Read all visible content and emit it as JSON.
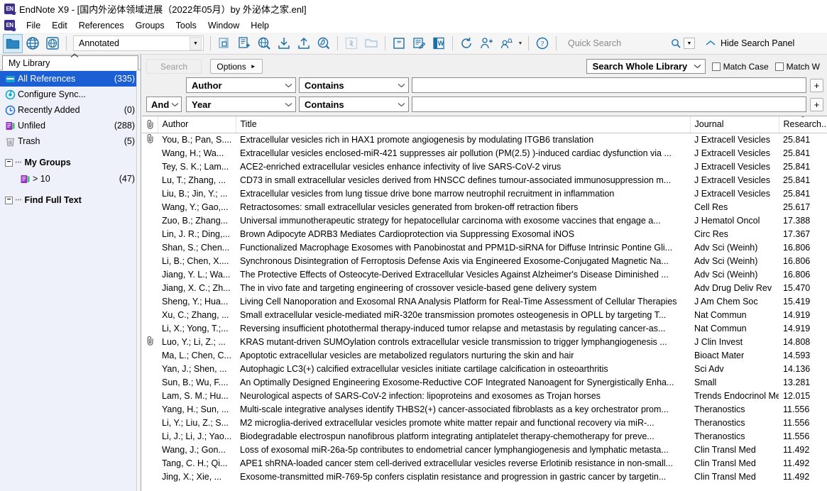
{
  "window": {
    "title": "EndNote X9 - [国内外泌体领域进展（2022年05月）by 外泌体之家.enl]",
    "logo_text": "EN"
  },
  "menu": {
    "items": [
      "File",
      "Edit",
      "References",
      "Groups",
      "Tools",
      "Window",
      "Help"
    ]
  },
  "toolbar": {
    "style_select": "Annotated",
    "icons": [
      "open-library-icon",
      "online-search-icon",
      "online-search-mode-icon",
      "copy-references-icon",
      "new-reference-icon",
      "online-search-find-icon",
      "import-icon",
      "export-icon",
      "find-full-text-icon",
      "link-icon",
      "open-file-folder-icon",
      "insert-citation-icon",
      "format-bibliography-icon",
      "word-icon",
      "sync-icon",
      "share-library-icon",
      "activity-feed-icon",
      "help-icon"
    ],
    "quick_search_placeholder": "Quick Search",
    "hide_search_panel": "Hide Search Panel"
  },
  "sidebar": {
    "library_tab": "My Library",
    "items": [
      {
        "label": "All References",
        "count": "(335)",
        "icon": "all-references-icon",
        "selected": true
      },
      {
        "label": "Configure Sync...",
        "count": "",
        "icon": "sync-config-icon",
        "selected": false
      },
      {
        "label": "Recently Added",
        "count": "(0)",
        "icon": "recently-added-icon",
        "selected": false
      },
      {
        "label": "Unfiled",
        "count": "(288)",
        "icon": "unfiled-icon",
        "selected": false
      },
      {
        "label": "Trash",
        "count": "(5)",
        "icon": "trash-icon",
        "selected": false
      }
    ],
    "my_groups_header": "My Groups",
    "groups": [
      {
        "label": "> 10",
        "count": "(47)",
        "icon": "group-icon"
      }
    ],
    "find_full_text_header": "Find Full Text"
  },
  "search_panel": {
    "search_button": "Search",
    "options_button": "Options",
    "scope_select": "Search Whole Library",
    "match_case": "Match Case",
    "match_words": "Match W",
    "rows": [
      {
        "bool": "",
        "field": "Author",
        "operator": "Contains",
        "term": ""
      },
      {
        "bool": "And",
        "field": "Year",
        "operator": "Contains",
        "term": ""
      }
    ],
    "add_row_label": "+"
  },
  "table": {
    "columns": {
      "clip": "",
      "author": "Author",
      "title": "Title",
      "journal": "Journal",
      "rating": "Research..."
    },
    "sort_column": "rating",
    "sort_direction": "descending",
    "rows": [
      {
        "clip": true,
        "author": "You, B.; Pan, S....",
        "title": "Extracellular vesicles rich in HAX1 promote angiogenesis by modulating ITGB6 translation",
        "journal": "J Extracell Vesicles",
        "rating": "25.841"
      },
      {
        "clip": false,
        "author": "Wang, H.; Wa...",
        "title": "Extracellular vesicles enclosed-miR-421 suppresses air pollution (PM(2.5) )-induced cardiac dysfunction via ...",
        "journal": "J Extracell Vesicles",
        "rating": "25.841"
      },
      {
        "clip": false,
        "author": "Tey, S. K.; Lam...",
        "title": "ACE2-enriched extracellular vesicles enhance infectivity of live SARS-CoV-2 virus",
        "journal": "J Extracell Vesicles",
        "rating": "25.841"
      },
      {
        "clip": false,
        "author": "Lu, T.; Zhang, ...",
        "title": "CD73 in small extracellular vesicles derived from HNSCC defines tumour-associated immunosuppression m...",
        "journal": "J Extracell Vesicles",
        "rating": "25.841"
      },
      {
        "clip": false,
        "author": "Liu, B.; Jin, Y.; ...",
        "title": "Extracellular vesicles from lung tissue drive bone marrow neutrophil recruitment in inflammation",
        "journal": "J Extracell Vesicles",
        "rating": "25.841"
      },
      {
        "clip": false,
        "author": "Wang, Y.; Gao,...",
        "title": "Retractosomes: small extracellular vesicles generated from broken-off retraction fibers",
        "journal": "Cell Res",
        "rating": "25.617"
      },
      {
        "clip": false,
        "author": "Zuo, B.; Zhang...",
        "title": "Universal immunotherapeutic strategy for hepatocellular carcinoma with exosome vaccines that engage a...",
        "journal": "J Hematol Oncol",
        "rating": "17.388"
      },
      {
        "clip": false,
        "author": "Lin, J. R.; Ding,...",
        "title": "Brown Adipocyte ADRB3 Mediates Cardioprotection via Suppressing Exosomal iNOS",
        "journal": "Circ Res",
        "rating": "17.367"
      },
      {
        "clip": false,
        "author": "Shan, S.; Chen...",
        "title": "Functionalized Macrophage Exosomes with Panobinostat and PPM1D-siRNA for Diffuse Intrinsic Pontine Gli...",
        "journal": "Adv Sci (Weinh)",
        "rating": "16.806"
      },
      {
        "clip": false,
        "author": "Li, B.; Chen, X....",
        "title": "Synchronous Disintegration of Ferroptosis Defense Axis via Engineered Exosome-Conjugated Magnetic Na...",
        "journal": "Adv Sci (Weinh)",
        "rating": "16.806"
      },
      {
        "clip": false,
        "author": "Jiang, Y. L.; Wa...",
        "title": "The Protective Effects of Osteocyte-Derived Extracellular Vesicles Against Alzheimer's Disease Diminished ...",
        "journal": "Adv Sci (Weinh)",
        "rating": "16.806"
      },
      {
        "clip": false,
        "author": "Jiang, X. C.; Zh...",
        "title": "The in vivo fate and targeting engineering of crossover vesicle-based gene delivery system",
        "journal": "Adv Drug Deliv Rev",
        "rating": "15.470"
      },
      {
        "clip": false,
        "author": "Sheng, Y.; Hua...",
        "title": "Living Cell Nanoporation and Exosomal RNA Analysis Platform for Real-Time Assessment of Cellular Therapies",
        "journal": "J Am Chem Soc",
        "rating": "15.419"
      },
      {
        "clip": false,
        "author": "Xu, C.; Zhang, ...",
        "title": "Small extracellular vesicle-mediated miR-320e transmission promotes osteogenesis in OPLL by targeting T...",
        "journal": "Nat Commun",
        "rating": "14.919"
      },
      {
        "clip": false,
        "author": "Li, X.; Yong, T.;...",
        "title": "Reversing insufficient photothermal therapy-induced tumor relapse and metastasis by regulating cancer-as...",
        "journal": "Nat Commun",
        "rating": "14.919"
      },
      {
        "clip": true,
        "author": "Luo, Y.; Li, Z.; ...",
        "title": "KRAS mutant-driven SUMOylation controls extracellular vesicle transmission to trigger lymphangiogenesis ...",
        "journal": "J Clin Invest",
        "rating": "14.808"
      },
      {
        "clip": false,
        "author": "Ma, L.; Chen, C...",
        "title": "Apoptotic extracellular vesicles are metabolized regulators nurturing the skin and hair",
        "journal": "Bioact Mater",
        "rating": "14.593"
      },
      {
        "clip": false,
        "author": "Yan, J.; Shen, ...",
        "title": "Autophagic LC3(+) calcified extracellular vesicles initiate cartilage calcification in osteoarthritis",
        "journal": "Sci Adv",
        "rating": "14.136"
      },
      {
        "clip": false,
        "author": "Sun, B.; Wu, F....",
        "title": "An Optimally Designed Engineering Exosome-Reductive COF Integrated Nanoagent for Synergistically Enha...",
        "journal": "Small",
        "rating": "13.281"
      },
      {
        "clip": false,
        "author": "Lam, S. M.; Hu...",
        "title": "Neurological aspects of SARS-CoV-2 infection: lipoproteins and exosomes as Trojan horses",
        "journal": "Trends Endocrinol Me...",
        "rating": "12.015"
      },
      {
        "clip": false,
        "author": "Yang, H.; Sun, ...",
        "title": "Multi-scale integrative analyses identify THBS2(+) cancer-associated fibroblasts as a key orchestrator prom...",
        "journal": "Theranostics",
        "rating": "11.556"
      },
      {
        "clip": false,
        "author": "Li, Y.; Liu, Z.; S...",
        "title": "M2 microglia-derived extracellular vesicles promote white matter repair and functional recovery via miR-...",
        "journal": "Theranostics",
        "rating": "11.556"
      },
      {
        "clip": false,
        "author": "Li, J.; Li, J.; Yao...",
        "title": "Biodegradable electrospun nanofibrous platform integrating antiplatelet therapy-chemotherapy for preve...",
        "journal": "Theranostics",
        "rating": "11.556"
      },
      {
        "clip": false,
        "author": "Wang, J.; Gon...",
        "title": "Loss of exosomal miR-26a-5p contributes to endometrial cancer lymphangiogenesis and lymphatic metasta...",
        "journal": "Clin Transl Med",
        "rating": "11.492"
      },
      {
        "clip": false,
        "author": "Tang, C. H.; Qi...",
        "title": "APE1 shRNA-loaded cancer stem cell-derived extracellular vesicles reverse Erlotinib resistance in non-small...",
        "journal": "Clin Transl Med",
        "rating": "11.492"
      },
      {
        "clip": false,
        "author": "Jing, X.; Xie, ...",
        "title": "Exosome-transmitted miR-769-5p confers cisplatin resistance and progression in gastric cancer by targetin...",
        "journal": "Clin Transl Med",
        "rating": "11.492"
      }
    ]
  },
  "colors": {
    "accent_blue": "#1c5fd4",
    "icon_blue": "#1b6ea8",
    "purple": "#8e2fc0",
    "cyan": "#00a0c6",
    "panel_gray": "#f0f0f0",
    "sidebar_bg": "#eef1f9"
  }
}
